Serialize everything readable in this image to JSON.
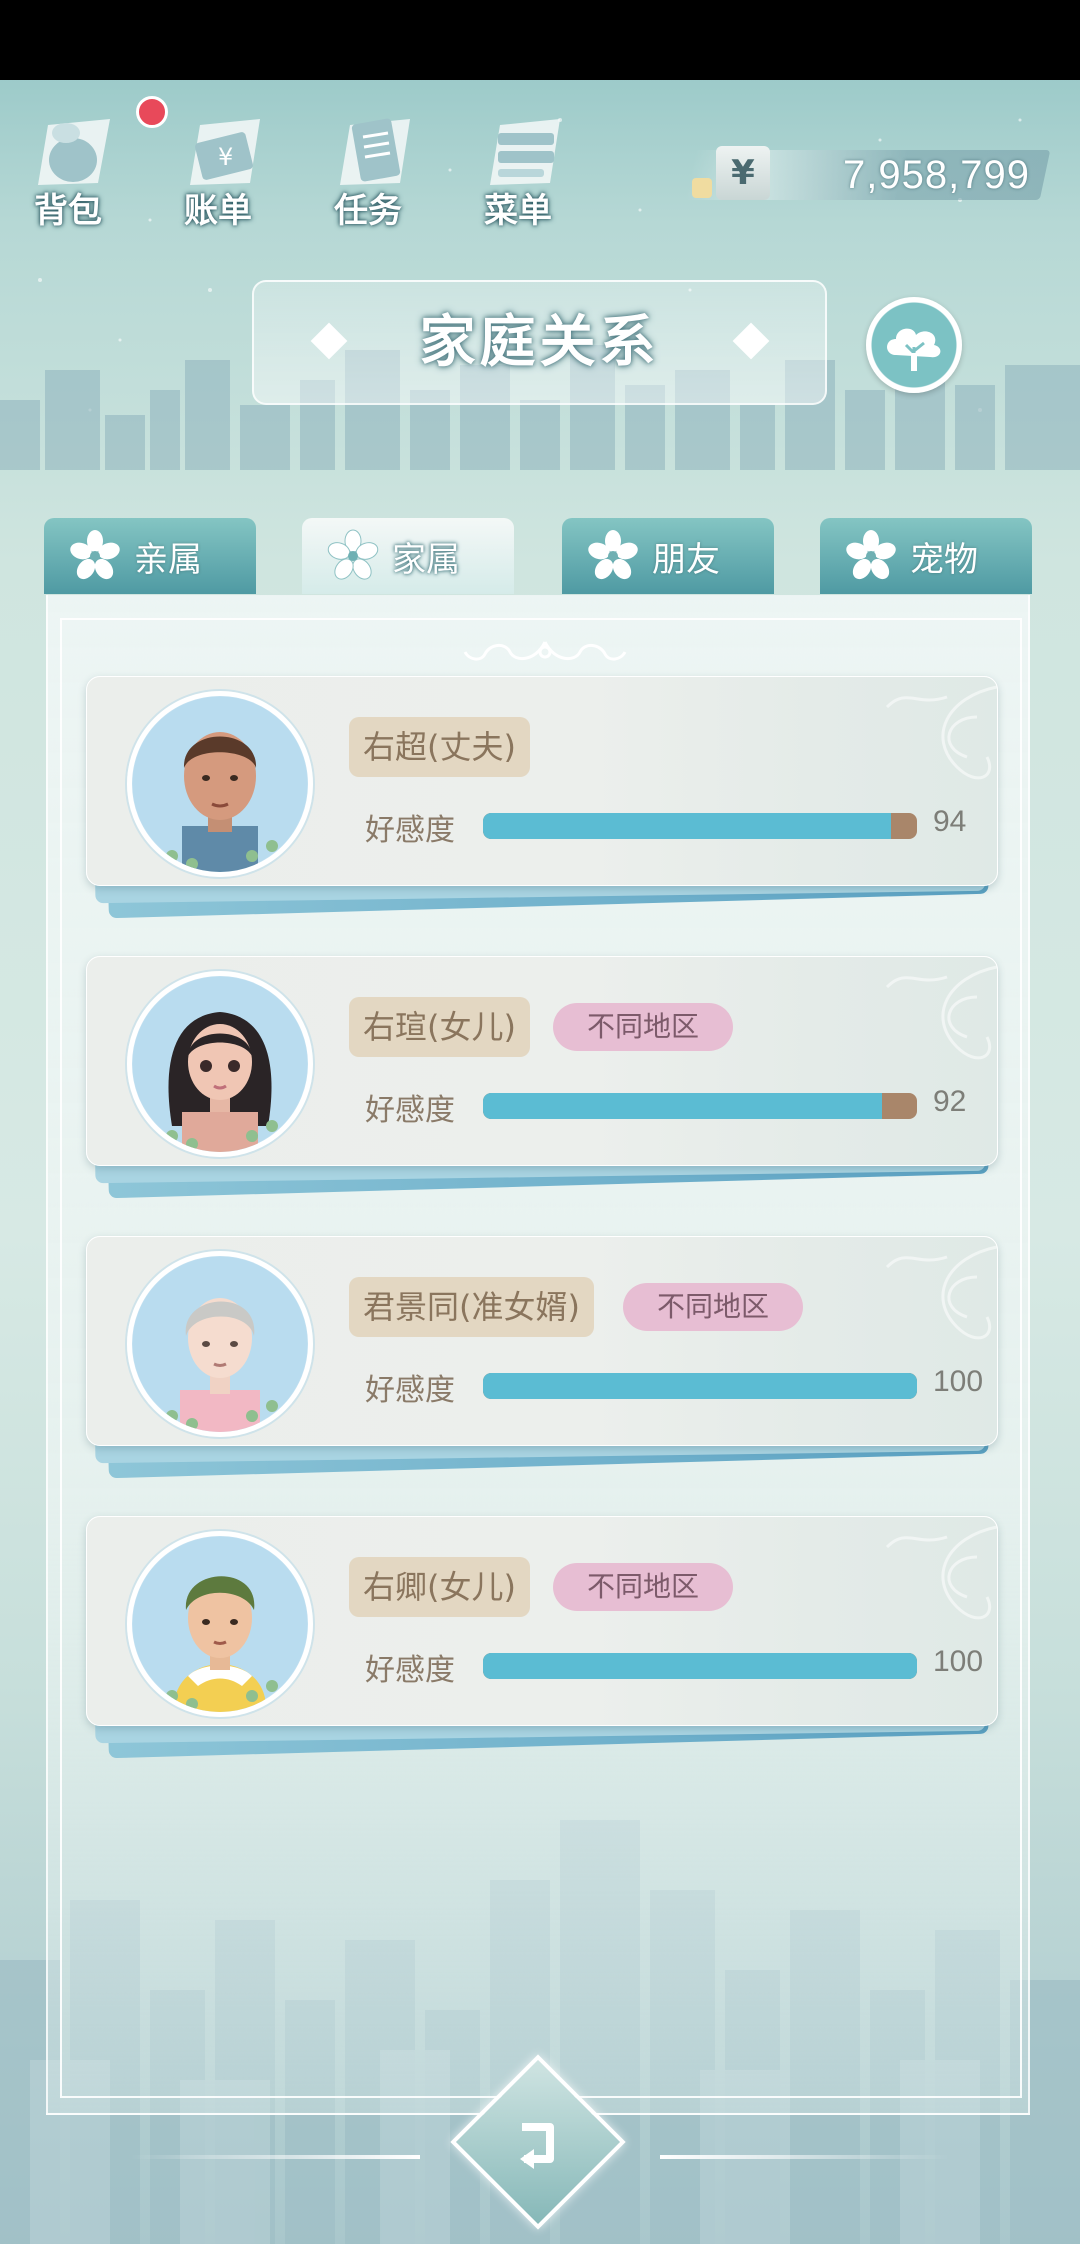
{
  "toolbar": {
    "bag_label": "背包",
    "bill_label": "账单",
    "task_label": "任务",
    "menu_label": "菜单"
  },
  "money": {
    "symbol": "¥",
    "value": "7,958,799"
  },
  "title": "家庭关系",
  "tabs": [
    {
      "label": "亲属",
      "active": false
    },
    {
      "label": "家属",
      "active": true
    },
    {
      "label": "朋友",
      "active": false
    },
    {
      "label": "宠物",
      "active": false
    }
  ],
  "affection_label": "好感度",
  "members": [
    {
      "name": "右超(丈夫)",
      "region": "",
      "affection": 94
    },
    {
      "name": "右瑄(女儿)",
      "region": "不同地区",
      "affection": 92
    },
    {
      "name": "君景同(准女婿)",
      "region": "不同地区",
      "affection": 100
    },
    {
      "name": "右卿(女儿)",
      "region": "不同地区",
      "affection": 100
    }
  ],
  "colors": {
    "bar_fill": "#5bbcd3",
    "bar_empty": "#a9866a",
    "region_tag": "#e7bed3",
    "name_tag": "#e3d7c2"
  }
}
